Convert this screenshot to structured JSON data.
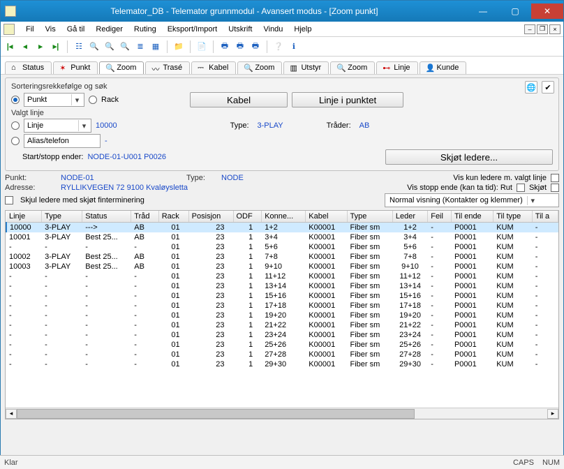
{
  "title": "Telemator_DB - Telemator grunnmodul - Avansert modus - [Zoom punkt]",
  "menu": [
    "Fil",
    "Vis",
    "Gå til",
    "Rediger",
    "Ruting",
    "Eksport/Import",
    "Utskrift",
    "Vindu",
    "Hjelp"
  ],
  "tabs": [
    {
      "label": "Status"
    },
    {
      "label": "Punkt"
    },
    {
      "label": "Zoom",
      "active": true
    },
    {
      "label": "Trasé"
    },
    {
      "label": "Kabel"
    },
    {
      "label": "Zoom"
    },
    {
      "label": "Utstyr"
    },
    {
      "label": "Zoom"
    },
    {
      "label": "Linje"
    },
    {
      "label": "Kunde"
    }
  ],
  "sort": {
    "header": "Sorteringsrekkefølge og søk",
    "option1": "Punkt",
    "option2": "Rack",
    "btn_kabel": "Kabel",
    "btn_linje": "Linje i punktet"
  },
  "valgt": {
    "header": "Valgt linje",
    "option1": "Linje",
    "value1": "10000",
    "type_label": "Type:",
    "type_value": "3-PLAY",
    "trader_label": "Tråder:",
    "trader_value": "AB",
    "option2": "Alias/telefon",
    "value2": "-",
    "start_label": "Start/stopp ender:",
    "start_value": "NODE-01-U001  P0026",
    "skjot_btn": "Skjøt ledere..."
  },
  "info": {
    "punkt_label": "Punkt:",
    "punkt_value": "NODE-01",
    "type_label": "Type:",
    "type_value": "NODE",
    "adresse_label": "Adresse:",
    "adresse_value": "RYLLIKVEGEN 72 9100 Kvaløysletta",
    "cb_skjotfinte": "Skjul ledere med skjøt finterminering",
    "cb_valgtlinje": "Vis kun ledere m. valgt linje",
    "stopp_label": "Vis stopp ende (kan ta tid): Rut",
    "skjot_cb": "Skjøt",
    "viewmode": "Normal visning (Kontakter og klemmer)"
  },
  "columns": [
    "Linje",
    "Type",
    "Status",
    "Tråd",
    "Rack",
    "Posisjon",
    "ODF",
    "Konne...",
    "Kabel",
    "Type",
    "Leder",
    "Feil",
    "Til ende",
    "Til type",
    "Til a"
  ],
  "rows": [
    {
      "linje": "10000",
      "type": "3-PLAY",
      "status": "--->",
      "trad": "AB",
      "rack": "01",
      "pos": "23",
      "odf": "1",
      "kon": "1+2",
      "kabel": "K00001",
      "ktype": "Fiber sm",
      "leder": "1+2",
      "feil": "-",
      "tilende": "P0001",
      "tiltype": "KUM",
      "tila": "-",
      "sel": true
    },
    {
      "linje": "10001",
      "type": "3-PLAY",
      "status": "Best 25...",
      "trad": "AB",
      "rack": "01",
      "pos": "23",
      "odf": "1",
      "kon": "3+4",
      "kabel": "K00001",
      "ktype": "Fiber sm",
      "leder": "3+4",
      "feil": "-",
      "tilende": "P0001",
      "tiltype": "KUM",
      "tila": "-"
    },
    {
      "linje": "-",
      "type": "-",
      "status": "-",
      "trad": "-",
      "rack": "01",
      "pos": "23",
      "odf": "1",
      "kon": "5+6",
      "kabel": "K00001",
      "ktype": "Fiber sm",
      "leder": "5+6",
      "feil": "-",
      "tilende": "P0001",
      "tiltype": "KUM",
      "tila": "-"
    },
    {
      "linje": "10002",
      "type": "3-PLAY",
      "status": "Best 25...",
      "trad": "AB",
      "rack": "01",
      "pos": "23",
      "odf": "1",
      "kon": "7+8",
      "kabel": "K00001",
      "ktype": "Fiber sm",
      "leder": "7+8",
      "feil": "-",
      "tilende": "P0001",
      "tiltype": "KUM",
      "tila": "-"
    },
    {
      "linje": "10003",
      "type": "3-PLAY",
      "status": "Best 25...",
      "trad": "AB",
      "rack": "01",
      "pos": "23",
      "odf": "1",
      "kon": "9+10",
      "kabel": "K00001",
      "ktype": "Fiber sm",
      "leder": "9+10",
      "feil": "-",
      "tilende": "P0001",
      "tiltype": "KUM",
      "tila": "-"
    },
    {
      "linje": "-",
      "type": "-",
      "status": "-",
      "trad": "-",
      "rack": "01",
      "pos": "23",
      "odf": "1",
      "kon": "11+12",
      "kabel": "K00001",
      "ktype": "Fiber sm",
      "leder": "11+12",
      "feil": "-",
      "tilende": "P0001",
      "tiltype": "KUM",
      "tila": "-"
    },
    {
      "linje": "-",
      "type": "-",
      "status": "-",
      "trad": "-",
      "rack": "01",
      "pos": "23",
      "odf": "1",
      "kon": "13+14",
      "kabel": "K00001",
      "ktype": "Fiber sm",
      "leder": "13+14",
      "feil": "-",
      "tilende": "P0001",
      "tiltype": "KUM",
      "tila": "-"
    },
    {
      "linje": "-",
      "type": "-",
      "status": "-",
      "trad": "-",
      "rack": "01",
      "pos": "23",
      "odf": "1",
      "kon": "15+16",
      "kabel": "K00001",
      "ktype": "Fiber sm",
      "leder": "15+16",
      "feil": "-",
      "tilende": "P0001",
      "tiltype": "KUM",
      "tila": "-"
    },
    {
      "linje": "-",
      "type": "-",
      "status": "-",
      "trad": "-",
      "rack": "01",
      "pos": "23",
      "odf": "1",
      "kon": "17+18",
      "kabel": "K00001",
      "ktype": "Fiber sm",
      "leder": "17+18",
      "feil": "-",
      "tilende": "P0001",
      "tiltype": "KUM",
      "tila": "-"
    },
    {
      "linje": "-",
      "type": "-",
      "status": "-",
      "trad": "-",
      "rack": "01",
      "pos": "23",
      "odf": "1",
      "kon": "19+20",
      "kabel": "K00001",
      "ktype": "Fiber sm",
      "leder": "19+20",
      "feil": "-",
      "tilende": "P0001",
      "tiltype": "KUM",
      "tila": "-"
    },
    {
      "linje": "-",
      "type": "-",
      "status": "-",
      "trad": "-",
      "rack": "01",
      "pos": "23",
      "odf": "1",
      "kon": "21+22",
      "kabel": "K00001",
      "ktype": "Fiber sm",
      "leder": "21+22",
      "feil": "-",
      "tilende": "P0001",
      "tiltype": "KUM",
      "tila": "-"
    },
    {
      "linje": "-",
      "type": "-",
      "status": "-",
      "trad": "-",
      "rack": "01",
      "pos": "23",
      "odf": "1",
      "kon": "23+24",
      "kabel": "K00001",
      "ktype": "Fiber sm",
      "leder": "23+24",
      "feil": "-",
      "tilende": "P0001",
      "tiltype": "KUM",
      "tila": "-"
    },
    {
      "linje": "-",
      "type": "-",
      "status": "-",
      "trad": "-",
      "rack": "01",
      "pos": "23",
      "odf": "1",
      "kon": "25+26",
      "kabel": "K00001",
      "ktype": "Fiber sm",
      "leder": "25+26",
      "feil": "-",
      "tilende": "P0001",
      "tiltype": "KUM",
      "tila": "-"
    },
    {
      "linje": "-",
      "type": "-",
      "status": "-",
      "trad": "-",
      "rack": "01",
      "pos": "23",
      "odf": "1",
      "kon": "27+28",
      "kabel": "K00001",
      "ktype": "Fiber sm",
      "leder": "27+28",
      "feil": "-",
      "tilende": "P0001",
      "tiltype": "KUM",
      "tila": "-"
    },
    {
      "linje": "-",
      "type": "-",
      "status": "-",
      "trad": "-",
      "rack": "01",
      "pos": "23",
      "odf": "1",
      "kon": "29+30",
      "kabel": "K00001",
      "ktype": "Fiber sm",
      "leder": "29+30",
      "feil": "-",
      "tilende": "P0001",
      "tiltype": "KUM",
      "tila": "-"
    }
  ],
  "status": {
    "ready": "Klar",
    "caps": "CAPS",
    "num": "NUM"
  }
}
